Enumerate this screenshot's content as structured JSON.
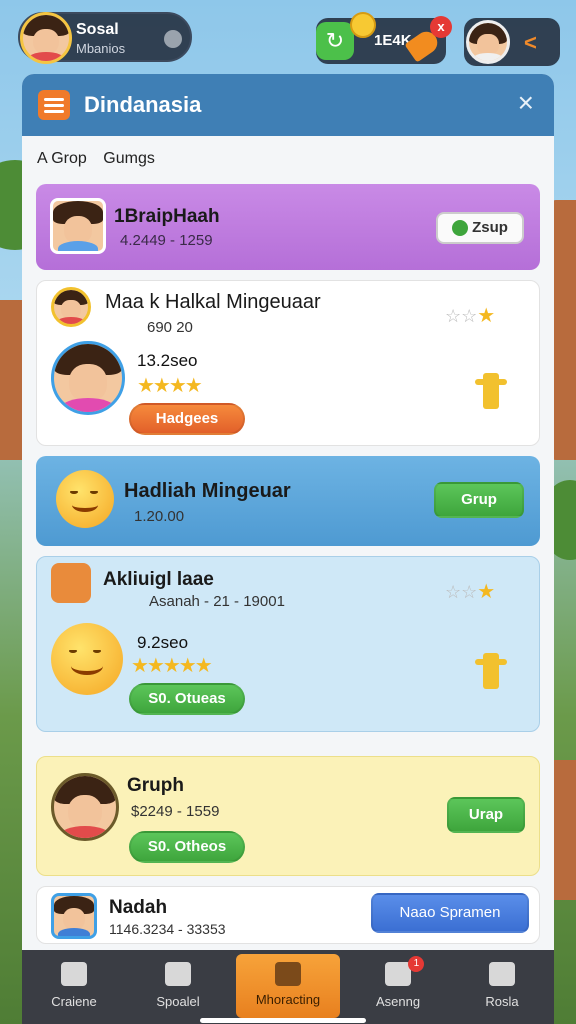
{
  "profile": {
    "name": "Sosal",
    "subtitle": "Mbanios"
  },
  "currency": {
    "value": "1E4K"
  },
  "panel": {
    "title": "Dindanasia",
    "close_label": "×"
  },
  "tabs": [
    "A Grop",
    "Gumgs"
  ],
  "cards": [
    {
      "title": "1BraipHaah",
      "meta": "4.2449 - 1259",
      "button": "Zsup"
    },
    {
      "title": "Maa k Halkal Mingeuaar",
      "meta": "690 20",
      "score": "13.2seo",
      "button": "Hadgees"
    },
    {
      "title": "Hadliah Mingeuar",
      "meta": "1.20.00",
      "button": "Grup"
    },
    {
      "title": "Akliuigl laae",
      "meta": "Asanah - 21 - 19001",
      "score": "9.2seo",
      "button": "S0. Otueas"
    },
    {
      "title": "Gruph",
      "meta": "$2249 - 1559",
      "button": "S0. Otheos",
      "side_button": "Urap"
    },
    {
      "title": "Nadah",
      "meta": "1146.3234 - 33353",
      "button": "Naao Spramen"
    }
  ],
  "nav": [
    {
      "label": "Craiene",
      "icon": "home-icon"
    },
    {
      "label": "Spoalel",
      "icon": "book-icon"
    },
    {
      "label": "Mhoracting",
      "icon": "box-icon",
      "active": true
    },
    {
      "label": "Asenng",
      "icon": "shield-icon",
      "badge": "1"
    },
    {
      "label": "Rosla",
      "icon": "person-icon"
    }
  ]
}
